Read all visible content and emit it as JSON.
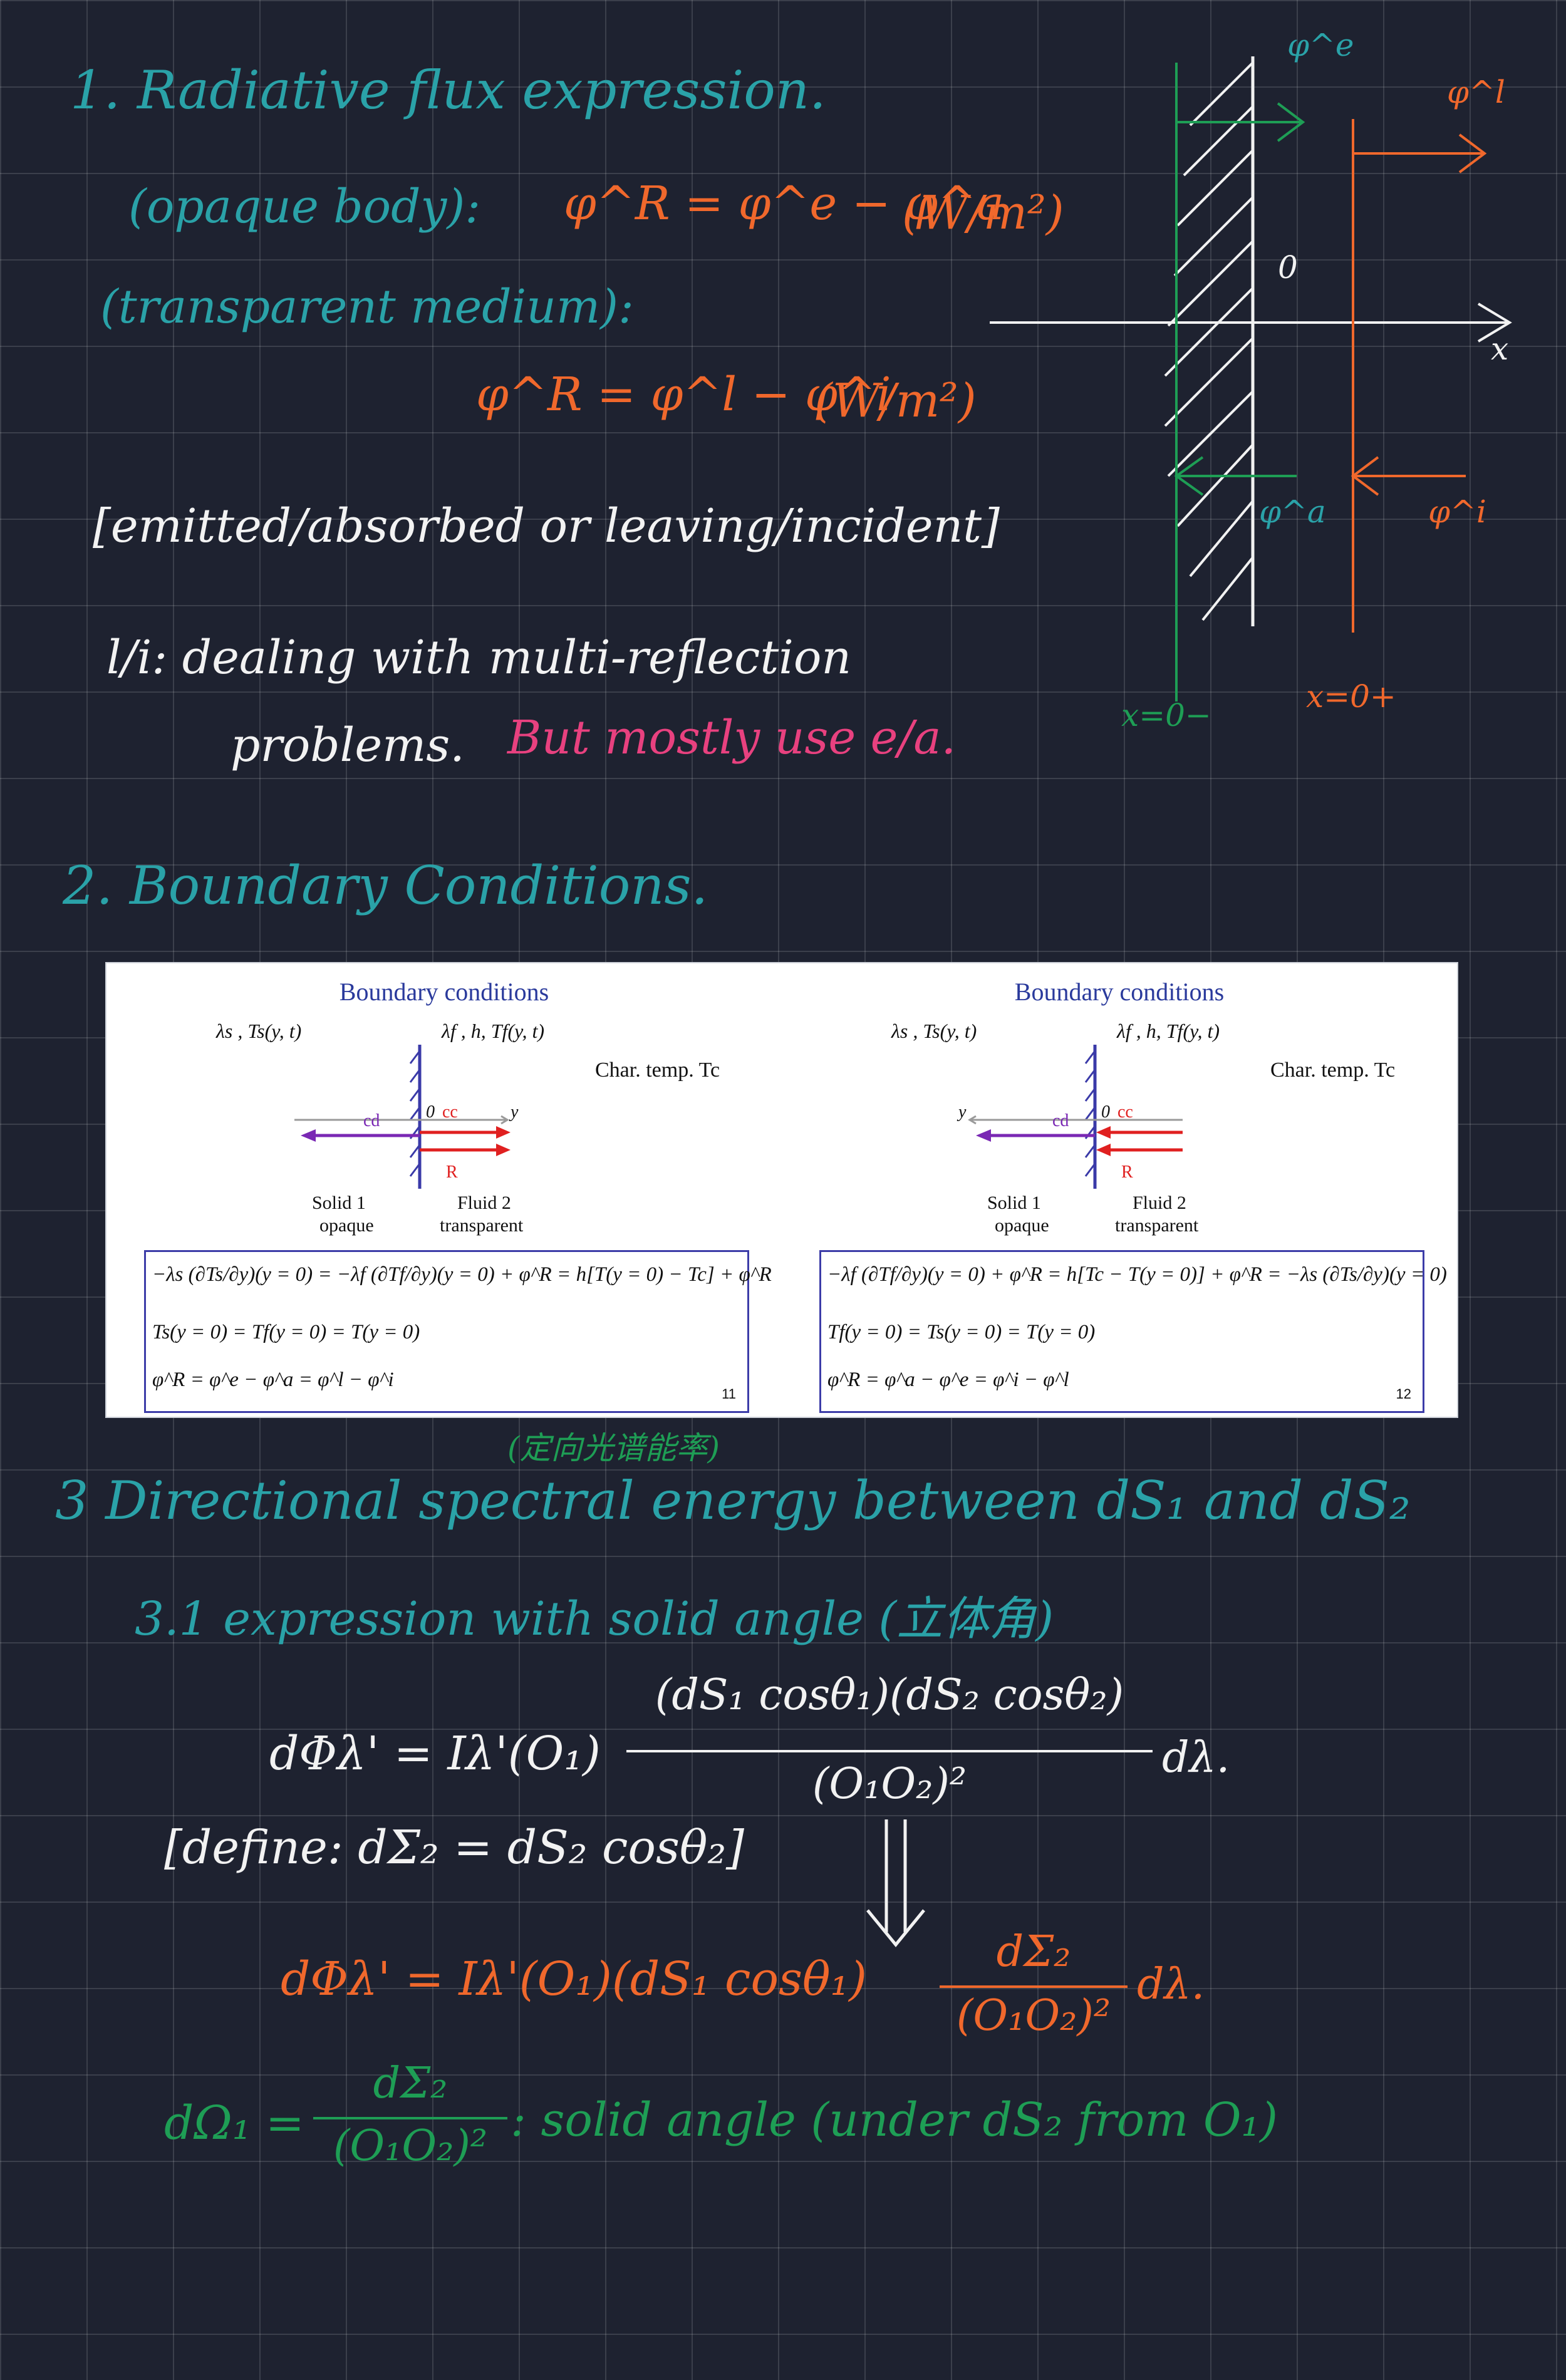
{
  "section1": {
    "heading": "1. Radiative flux expression.",
    "opaque_label": "(opaque body):",
    "opaque_eq": "φ^R = φ^e − φ^a",
    "unit1": "(W/m²)",
    "transparent_label": "(transparent medium):",
    "transparent_eq": "φ^R = φ^l − φ^i",
    "unit2": "(W/m²)",
    "bracket_note": "[emitted/absorbed  or  leaving/incident]",
    "li_line": "l/i: dealing with multi-reflection",
    "problems": "problems.",
    "but_note": "But mostly use e/a."
  },
  "sketch": {
    "phi_e": "φ^e",
    "phi_l": "φ^l",
    "phi_a": "φ^a",
    "phi_i": "φ^i",
    "origin": "0",
    "axis": "x",
    "x0_minus": "x=0−",
    "x0_plus": "x=0+"
  },
  "section2": {
    "heading": "2. Boundary Conditions."
  },
  "slides": [
    {
      "title": "Boundary conditions",
      "left_props": "λs , Ts(y, t)",
      "right_props": "λf , h, Tf(y, t)",
      "char_temp": "Char. temp. Tc",
      "cc": "cc",
      "cd": "cd",
      "R": "R",
      "y": "y",
      "zero": "0",
      "solid": "Solid 1",
      "opaque": "opaque",
      "fluid": "Fluid 2",
      "transparent": "transparent",
      "eq1": "−λs (∂Ts/∂y)(y = 0) = −λf (∂Tf/∂y)(y = 0) + φ^R = h[T(y = 0) − Tc] + φ^R",
      "eq2": "Ts(y = 0) = Tf(y = 0) = T(y = 0)",
      "eq3": "φ^R = φ^e − φ^a = φ^l − φ^i",
      "page": "11"
    },
    {
      "title": "Boundary conditions",
      "left_props": "λs , Ts(y, t)",
      "right_props": "λf , h, Tf(y, t)",
      "char_temp": "Char. temp. Tc",
      "cc": "cc",
      "cd": "cd",
      "R": "R",
      "y": "y",
      "zero": "0",
      "solid": "Solid 1",
      "opaque": "opaque",
      "fluid": "Fluid 2",
      "transparent": "transparent",
      "eq1": "−λf (∂Tf/∂y)(y = 0) + φ^R = h[Tc − T(y = 0)] + φ^R = −λs (∂Ts/∂y)(y = 0)",
      "eq2": "Tf(y = 0) = Ts(y = 0) = T(y = 0)",
      "eq3": "φ^R = φ^a − φ^e = φ^i − φ^l",
      "page": "12"
    }
  ],
  "section3": {
    "chinese_note": "(定向光谱能率)",
    "heading": "3 Directional spectral energy between dS₁ and dS₂",
    "sub_heading": "3.1 expression with solid angle (立体角)",
    "eq_lhs": "dΦλ' = Iλ'(O₁)",
    "eq_num": "(dS₁ cosθ₁)(dS₂ cosθ₂)",
    "eq_den": "(O₁O₂)²",
    "eq_tail": "dλ.",
    "define": "[define: dΣ₂ = dS₂ cosθ₂]",
    "eq2_lhs": "dΦλ' = Iλ'(O₁)(dS₁ cosθ₁)",
    "eq2_num": "dΣ₂",
    "eq2_den": "(O₁O₂)²",
    "eq2_tail": "dλ.",
    "omega_lhs": "dΩ₁ =",
    "omega_num": "dΣ₂",
    "omega_den": "(O₁O₂)²",
    "omega_desc": ": solid angle (under dS₂ from O₁)"
  }
}
